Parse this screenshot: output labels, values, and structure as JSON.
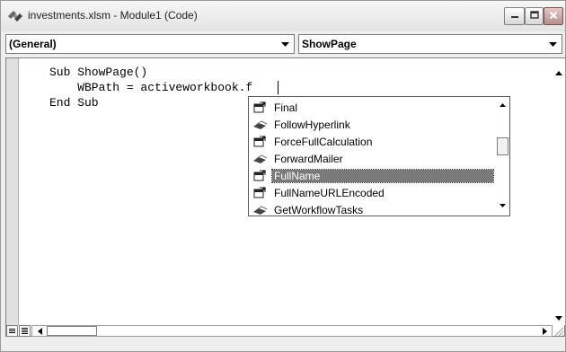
{
  "window": {
    "title": "investments.xlsm - Module1 (Code)",
    "icons": {
      "app": "vba-module-icon",
      "minimize": "minimize-icon",
      "maximize": "maximize-icon",
      "close": "close-icon"
    }
  },
  "combos": {
    "object": "(General)",
    "procedure": "ShowPage"
  },
  "code": {
    "lines": [
      "Sub ShowPage()",
      "    WBPath = activeworkbook.f",
      "End Sub"
    ]
  },
  "autolist": {
    "items": [
      {
        "label": "Final",
        "icon": "property-icon",
        "selected": false
      },
      {
        "label": "FollowHyperlink",
        "icon": "method-icon",
        "selected": false
      },
      {
        "label": "ForceFullCalculation",
        "icon": "property-icon",
        "selected": false
      },
      {
        "label": "ForwardMailer",
        "icon": "method-icon",
        "selected": false
      },
      {
        "label": "FullName",
        "icon": "property-icon",
        "selected": true
      },
      {
        "label": "FullNameURLEncoded",
        "icon": "property-icon",
        "selected": false
      },
      {
        "label": "GetWorkflowTasks",
        "icon": "method-icon",
        "selected": false
      }
    ]
  },
  "colors": {
    "selection": "#7a7a7a",
    "window_bg": "#eeeeee",
    "code_bg": "#ffffff"
  }
}
